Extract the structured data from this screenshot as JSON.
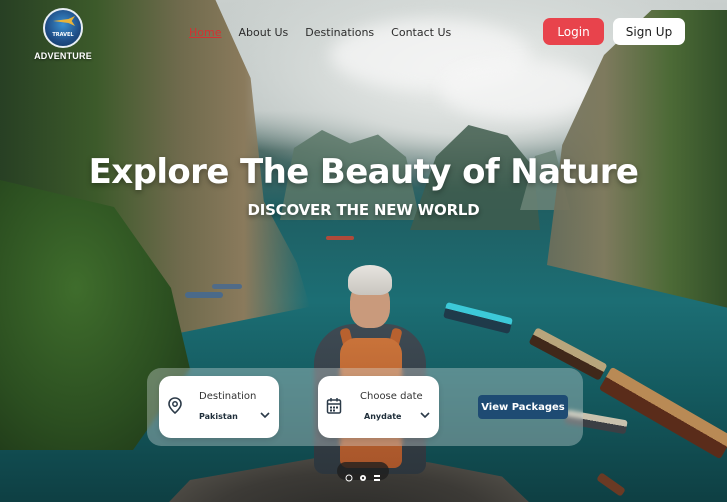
{
  "brand": {
    "name": "ADVENTURE",
    "badge_text": "TRAVEL"
  },
  "nav": {
    "items": [
      {
        "label": "Home",
        "active": true
      },
      {
        "label": "About Us",
        "active": false
      },
      {
        "label": "Destinations",
        "active": false
      },
      {
        "label": "Contact Us",
        "active": false
      }
    ]
  },
  "auth": {
    "login_label": "Login",
    "signup_label": "Sign Up"
  },
  "hero": {
    "title": "Explore The Beauty of Nature",
    "subtitle": "DISCOVER THE NEW WORLD"
  },
  "search": {
    "destination": {
      "label": "Destination",
      "value": "Pakistan",
      "icon": "map-pin-icon"
    },
    "date": {
      "label": "Choose date",
      "value": "Anydate",
      "icon": "calendar-icon"
    },
    "submit_label": "View Packages"
  },
  "colors": {
    "login_bg": "#e8434c",
    "nav_active": "#d23232",
    "view_packages_bg": "#1e4b73"
  }
}
